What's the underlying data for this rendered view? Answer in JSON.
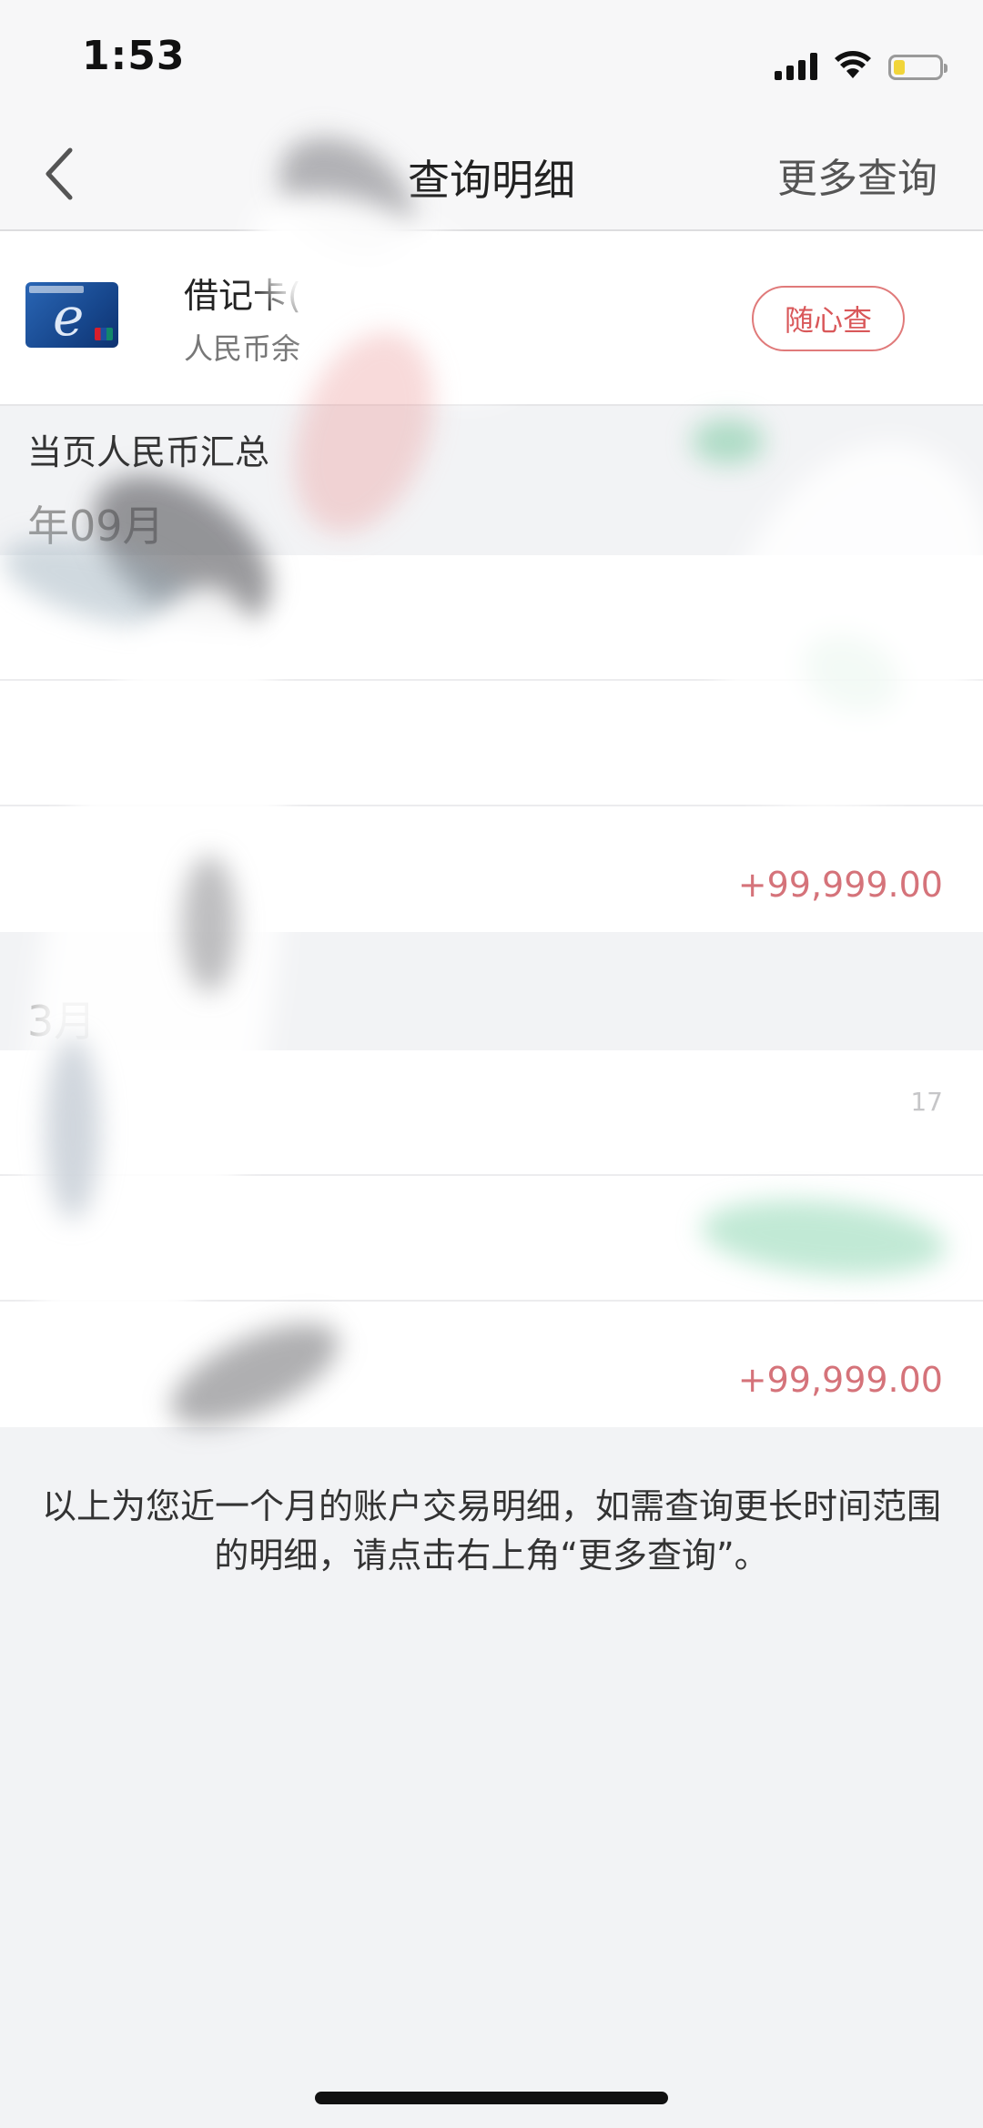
{
  "status_bar": {
    "time": "1:53"
  },
  "nav": {
    "title": "查询明细",
    "more_query_label": "更多查询"
  },
  "account": {
    "card_name": "借记卡(",
    "balance_label": "人民币余",
    "quick_query_label": "随心查"
  },
  "summary": {
    "title": "当页人民币汇总"
  },
  "months": [
    {
      "label": "年09月",
      "rows": [
        {
          "amount": "",
          "time": ""
        },
        {
          "amount": "",
          "time": ""
        },
        {
          "amount": "+99,999.00",
          "time": ""
        }
      ]
    },
    {
      "label": "3月",
      "rows": [
        {
          "amount": "",
          "time": "17"
        },
        {
          "amount": "",
          "time": ""
        },
        {
          "amount": "+99,999.00",
          "time": ""
        }
      ]
    }
  ],
  "footer": {
    "note": "以上为您近一个月的账户交易明细，如需查询更长时间范围的明细，请点击右上角“更多查询”。"
  },
  "colors": {
    "accent_red": "#d9585a",
    "amount_red": "#d5737a",
    "background": "#f2f3f5",
    "card_blue": "#17478d"
  },
  "icons": {
    "back": "chevron-left-icon",
    "signal": "cellular-signal-icon",
    "wifi": "wifi-icon",
    "battery": "battery-icon",
    "card_logo": "icbc-e-card-logo"
  }
}
